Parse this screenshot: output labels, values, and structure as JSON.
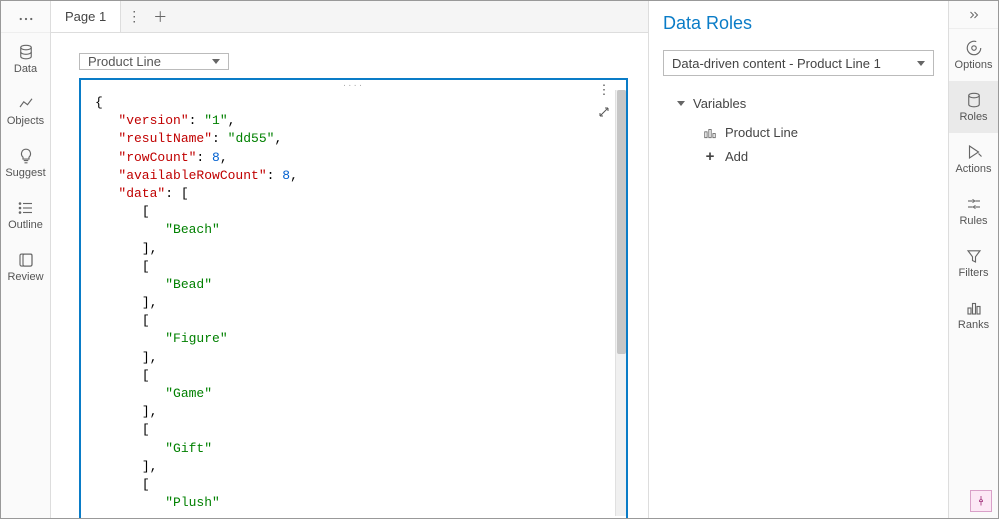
{
  "left_sidebar": {
    "items": [
      {
        "label": "Data"
      },
      {
        "label": "Objects"
      },
      {
        "label": "Suggest"
      },
      {
        "label": "Outline"
      },
      {
        "label": "Review"
      }
    ]
  },
  "tabs": {
    "active": "Page 1"
  },
  "canvas": {
    "select_value": "Product Line",
    "json": {
      "version_key": "\"version\"",
      "version_val": "\"1\"",
      "resultName_key": "\"resultName\"",
      "resultName_val": "\"dd55\"",
      "rowCount_key": "\"rowCount\"",
      "rowCount_val": "8",
      "availableRowCount_key": "\"availableRowCount\"",
      "availableRowCount_val": "8",
      "data_key": "\"data\"",
      "rows": [
        "\"Beach\"",
        "\"Bead\"",
        "\"Figure\"",
        "\"Game\"",
        "\"Gift\"",
        "\"Plush\""
      ]
    }
  },
  "right_panel": {
    "title": "Data Roles",
    "selector": "Data-driven content - Product Line 1",
    "section_label": "Variables",
    "var_item": "Product Line",
    "add_label": "Add"
  },
  "right_sidebar": {
    "items": [
      {
        "label": "Options"
      },
      {
        "label": "Roles"
      },
      {
        "label": "Actions"
      },
      {
        "label": "Rules"
      },
      {
        "label": "Filters"
      },
      {
        "label": "Ranks"
      }
    ]
  }
}
